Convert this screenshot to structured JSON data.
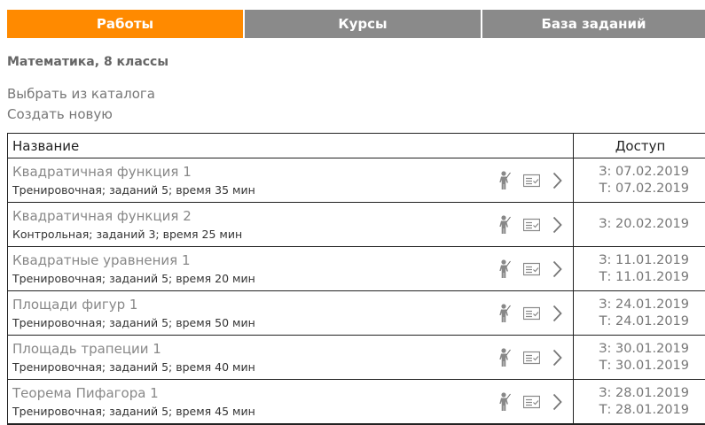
{
  "tabs": [
    {
      "label": "Работы",
      "active": true
    },
    {
      "label": "Курсы",
      "active": false
    },
    {
      "label": "База заданий",
      "active": false
    }
  ],
  "subject": "Математика, 8 классы",
  "links": {
    "catalog": "Выбрать из каталога",
    "create": "Создать новую"
  },
  "table": {
    "headers": {
      "name": "Название",
      "access": "Доступ"
    },
    "rows": [
      {
        "title": "Квадратичная функция 1",
        "desc": "Тренировочная; заданий 5; время 35 мин",
        "access1": "З: 07.02.2019",
        "access2": "Т: 07.02.2019"
      },
      {
        "title": "Квадратичная функция 2",
        "desc": "Контрольная; заданий 3; время 25 мин",
        "access1": "З: 20.02.2019",
        "access2": ""
      },
      {
        "title": "Квадратные уравнения 1",
        "desc": "Тренировочная; заданий 5; время 20 мин",
        "access1": "З: 11.01.2019",
        "access2": "Т: 11.01.2019"
      },
      {
        "title": "Площади фигур 1",
        "desc": "Тренировочная; заданий 5; время 50 мин",
        "access1": "З: 24.01.2019",
        "access2": "Т: 24.01.2019"
      },
      {
        "title": "Площадь трапеции 1",
        "desc": "Тренировочная; заданий 5; время 40 мин",
        "access1": "З: 30.01.2019",
        "access2": "Т: 30.01.2019"
      },
      {
        "title": "Теорема Пифагора 1",
        "desc": "Тренировочная; заданий 5; время 45 мин",
        "access1": "З: 28.01.2019",
        "access2": "Т: 28.01.2019"
      }
    ]
  },
  "colors": {
    "accent": "#ff8a00",
    "tab_inactive": "#8a8a8a"
  },
  "icons": [
    "teacher-icon",
    "checklist-icon",
    "chevron-right-icon"
  ]
}
